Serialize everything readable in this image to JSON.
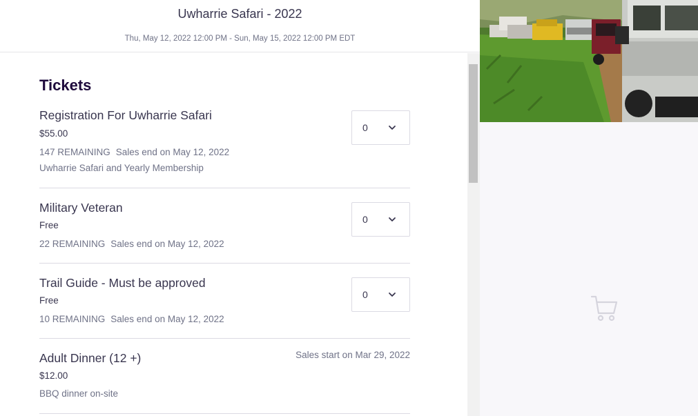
{
  "event": {
    "title": "Uwharrie Safari - 2022",
    "dates": "Thu, May 12, 2022 12:00 PM - Sun, May 15, 2022 12:00 PM EDT"
  },
  "tickets_heading": "Tickets",
  "tickets": [
    {
      "name": "Registration For Uwharrie Safari",
      "price": "$55.00",
      "remaining": "147 REMAINING",
      "sales": "Sales end on May 12, 2022",
      "description": "Uwharrie Safari and Yearly Membership",
      "quantity": "0"
    },
    {
      "name": "Military Veteran",
      "price": "Free",
      "remaining": "22 REMAINING",
      "sales": "Sales end on May 12, 2022",
      "quantity": "0"
    },
    {
      "name": "Trail Guide - Must be approved",
      "price": "Free",
      "remaining": "10 REMAINING",
      "sales": "Sales end on May 12, 2022",
      "quantity": "0"
    },
    {
      "name": "Adult Dinner (12 +)",
      "price": "$12.00",
      "sales_start": "Sales start on Mar 29, 2022",
      "description": "BBQ dinner on-site"
    }
  ],
  "icons": {
    "quantity_dropdown": "chevron-down-icon",
    "empty_cart": "shopping-cart-icon"
  },
  "colors": {
    "heading": "#1e0a3c",
    "text": "#39364f",
    "muted": "#6f7287",
    "side_panel": "#f8f7fa"
  }
}
